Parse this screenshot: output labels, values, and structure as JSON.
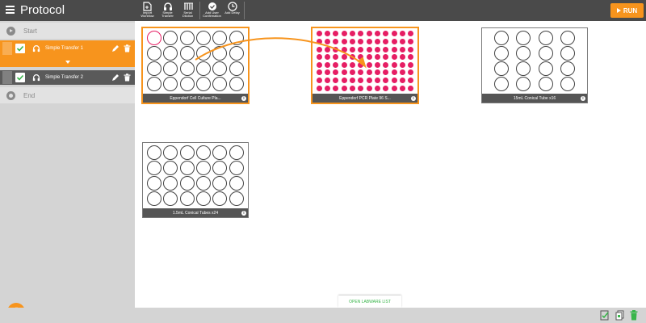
{
  "app": {
    "title": "Protocol"
  },
  "toolbar": {
    "tools": [
      {
        "label": "Import\nWorkflow"
      },
      {
        "label": "Simple\nTransfer"
      },
      {
        "label": "Serial\nDilution"
      },
      {
        "label": "Add User\nConfirmation"
      },
      {
        "label": "Add Delay"
      }
    ],
    "run_label": "RUN"
  },
  "sidebar": {
    "start_label": "Start",
    "steps": [
      {
        "label": "Simple Transfer 1",
        "checked": true,
        "selected": true
      },
      {
        "label": "Simple Transfer 2",
        "checked": true,
        "selected": false
      }
    ],
    "end_label": "End"
  },
  "labware": [
    {
      "name": "Eppendorf Cell Culture Pla...",
      "rows": 4,
      "cols": 6,
      "selected": true,
      "role": "source"
    },
    {
      "name": "Eppendorf PCR Plate 96 S...",
      "rows": 8,
      "cols": 12,
      "selected": true,
      "role": "destination"
    },
    {
      "name": "15mL Conical Tube x16",
      "rows": 4,
      "cols": 4,
      "selected": false
    },
    {
      "name": "1.5mL Conical Tubes x24",
      "rows": 4,
      "cols": 6,
      "selected": false
    }
  ],
  "footer": {
    "open_labware_label": "OPEN LABWARE LIST"
  },
  "colors": {
    "accent": "#f7941d",
    "well_fill": "#e61e64",
    "topbar": "#4a4a4a",
    "sidebar": "#d4d4d4",
    "selected_step_bg": "#f7941d",
    "step_bg": "#5a5a5a",
    "check": "#39b54a"
  },
  "icons": {
    "menu": "menu-icon",
    "transfer": "headphones-icon",
    "edit": "pencil-icon",
    "delete": "trash-icon",
    "notes": "clipboard-icon",
    "info": "info-icon"
  }
}
